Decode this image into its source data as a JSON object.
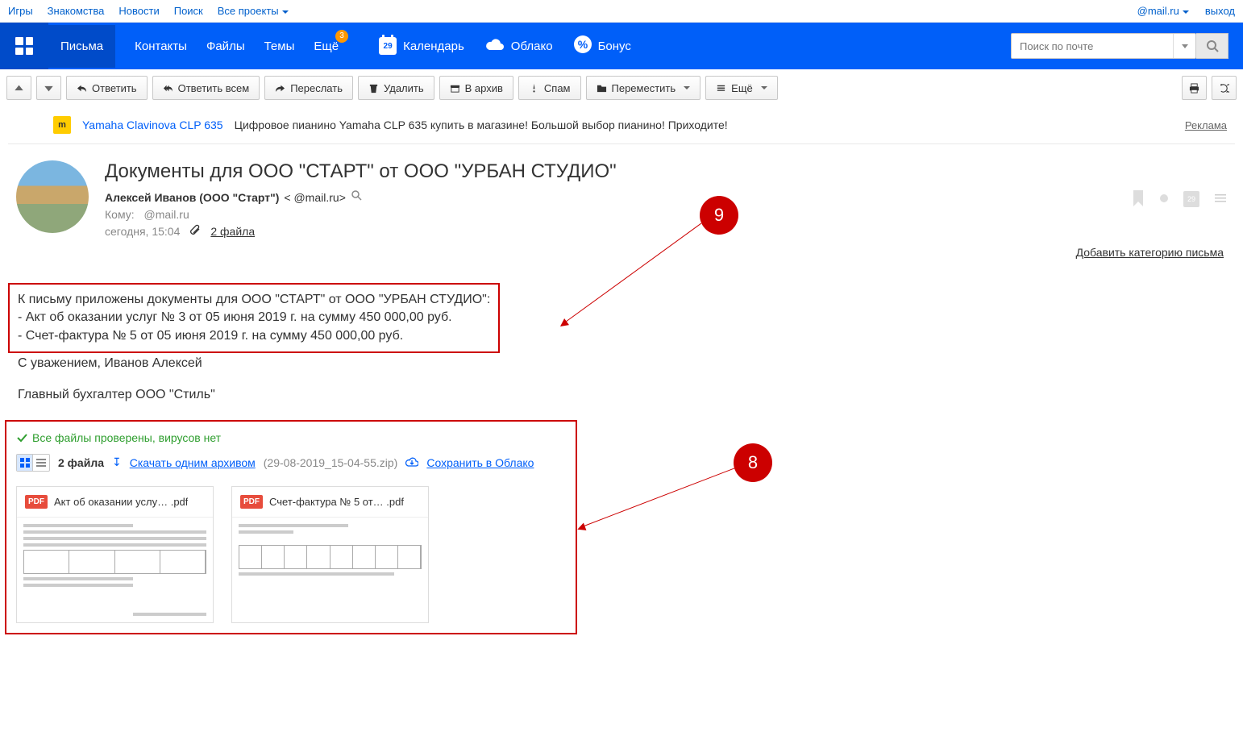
{
  "top_nav": {
    "left": [
      "Игры",
      "Знакомства",
      "Новости",
      "Поиск",
      "Все проекты"
    ],
    "right_email": "@mail.ru",
    "logout": "выход"
  },
  "main_nav": {
    "tabs": [
      "Письма",
      "Контакты",
      "Файлы",
      "Темы",
      "Ещё"
    ],
    "more_badge": "3",
    "extras": {
      "calendar_day": "29",
      "calendar": "Календарь",
      "cloud": "Облако",
      "bonus": "Бонус"
    },
    "search_placeholder": "Поиск по почте"
  },
  "toolbar": {
    "reply": "Ответить",
    "reply_all": "Ответить всем",
    "forward": "Переслать",
    "delete": "Удалить",
    "archive": "В архив",
    "spam": "Спам",
    "move": "Переместить",
    "more": "Ещё"
  },
  "ad": {
    "link": "Yamaha Clavinova CLP 635",
    "text": "Цифровое пианино Yamaha CLP 635 купить в магазине! Большой выбор пианино! Приходите!",
    "label": "Реклама"
  },
  "email": {
    "subject": "Документы для ООО \"СТАРТ\" от ООО \"УРБАН СТУДИО\"",
    "from_name": "Алексей Иванов (ООО \"Старт\")",
    "from_email": "<         @mail.ru>",
    "to_label": "Кому:",
    "to_addr": "@mail.ru",
    "date": "сегодня, 15:04",
    "attach_count": "2 файла",
    "add_category": "Добавить категорию письма",
    "cal_icon_day": "29"
  },
  "body": {
    "l1": "К письму приложены документы для ООО \"СТАРТ\" от ООО \"УРБАН СТУДИО\":",
    "l2": "- Акт об оказании услуг № 3 от 05 июня 2019 г. на сумму 450 000,00 руб.",
    "l3": "- Счет-фактура № 5 от 05 июня 2019 г. на сумму 450 000,00 руб.",
    "l4": "С уважением, Иванов Алексей",
    "l5": "Главный бухгалтер ООО \"Стиль\""
  },
  "attachments": {
    "virus_ok": "Все файлы проверены, вирусов нет",
    "count": "2 файла",
    "download_archive": "Скачать одним архивом",
    "archive_name": "(29-08-2019_15-04-55.zip)",
    "save_cloud": "Сохранить в Облако",
    "files": [
      {
        "name": "Акт об оказании услу… .pdf"
      },
      {
        "name": "Счет-фактура № 5 от… .pdf"
      }
    ]
  },
  "callouts": {
    "c1": "9",
    "c2": "8"
  }
}
